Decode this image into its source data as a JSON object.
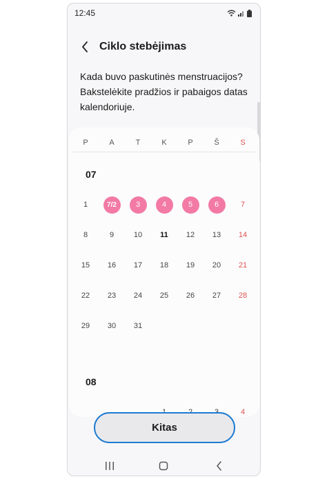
{
  "status": {
    "time": "12:45"
  },
  "header": {
    "title": "Ciklo stebėjimas"
  },
  "instructions": "Kada buvo paskutinės menstruacijos? Bakstelėkite pradžios ir pabaigos datas kalendoriuje.",
  "calendar": {
    "weekdays": [
      "P",
      "A",
      "T",
      "K",
      "P",
      "Š",
      "S"
    ],
    "months": [
      {
        "label": "07",
        "weeks": [
          [
            "1",
            "7/2",
            "3",
            "4",
            "5",
            "6",
            "7"
          ],
          [
            "8",
            "9",
            "10",
            "11",
            "12",
            "13",
            "14"
          ],
          [
            "15",
            "16",
            "17",
            "18",
            "19",
            "20",
            "21"
          ],
          [
            "22",
            "23",
            "24",
            "25",
            "26",
            "27",
            "28"
          ],
          [
            "29",
            "30",
            "31",
            "",
            "",
            "",
            ""
          ]
        ],
        "period_days": [
          "7/2",
          "3",
          "4",
          "5",
          "6"
        ],
        "today": "11"
      },
      {
        "label": "08",
        "weeks": [
          [
            "",
            "",
            "",
            "1",
            "2",
            "3",
            "4"
          ]
        ]
      }
    ]
  },
  "next_button": {
    "label": "Kitas"
  },
  "colors": {
    "period": "#f27aa5",
    "sunday": "#e0524f",
    "focus_ring": "#1c7ad1"
  },
  "icons": [
    "wifi-icon",
    "signal-icon",
    "battery-icon",
    "back-arrow-icon",
    "recent-apps-icon",
    "home-icon",
    "nav-back-icon"
  ]
}
